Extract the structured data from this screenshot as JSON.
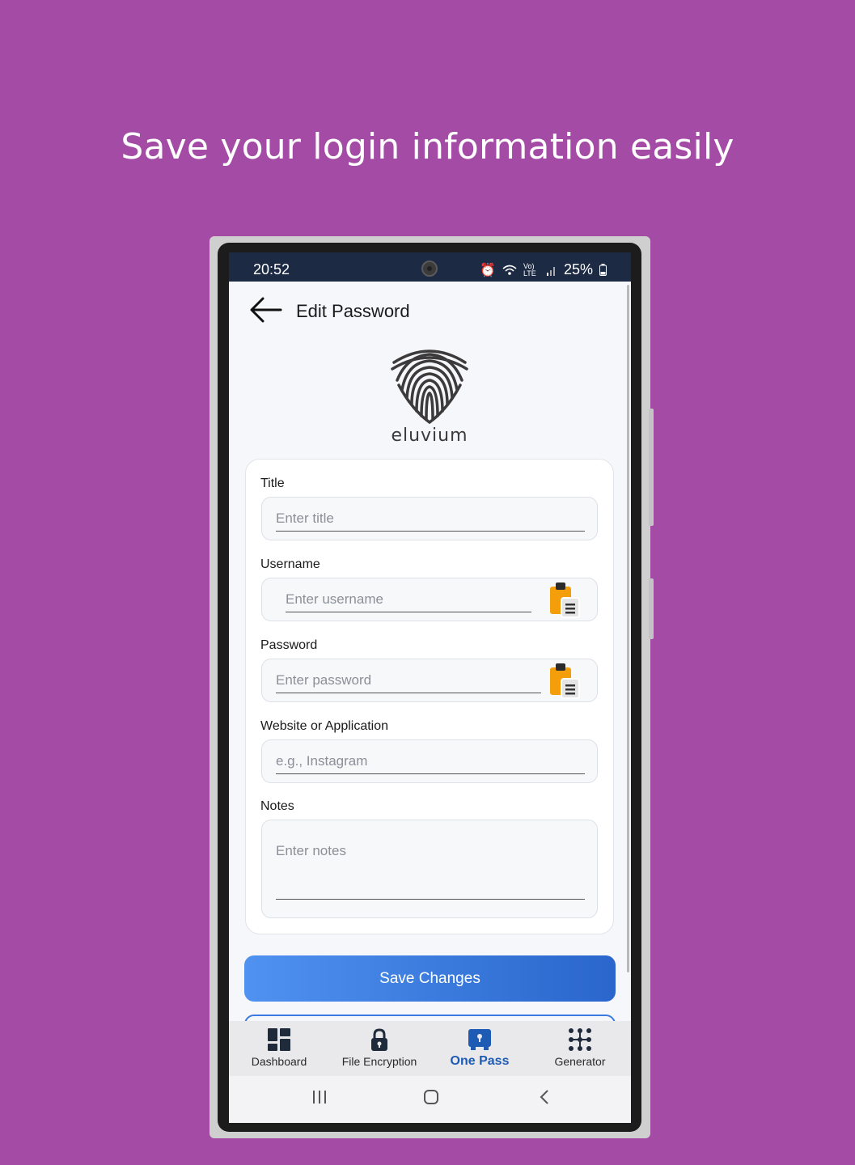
{
  "headline": "Save your login information easily",
  "status": {
    "time": "20:52",
    "network": "Vo) LTE",
    "battery": "25%"
  },
  "appbar": {
    "title": "Edit Password"
  },
  "logo": {
    "text": "eluvium"
  },
  "form": {
    "title": {
      "label": "Title",
      "placeholder": "Enter title"
    },
    "username": {
      "label": "Username",
      "placeholder": "Enter username"
    },
    "password": {
      "label": "Password",
      "placeholder": "Enter password"
    },
    "website": {
      "label": "Website or Application",
      "placeholder": "e.g., Instagram"
    },
    "notes": {
      "label": "Notes",
      "placeholder": "Enter notes"
    }
  },
  "actions": {
    "save_label": "Save Changes"
  },
  "bottom_nav": {
    "items": [
      {
        "label": "Dashboard",
        "icon": "dashboard-icon"
      },
      {
        "label": "File Encryption",
        "icon": "lock-icon"
      },
      {
        "label": "One Pass",
        "icon": "vault-icon"
      },
      {
        "label": "Generator",
        "icon": "grid-dots-icon"
      }
    ],
    "active": "One Pass"
  },
  "colors": {
    "background": "#a44ba5",
    "accent": "#1e5bb5",
    "button_start": "#4f92f0",
    "button_end": "#2a66cc",
    "clipboard": "#f59e0b"
  }
}
